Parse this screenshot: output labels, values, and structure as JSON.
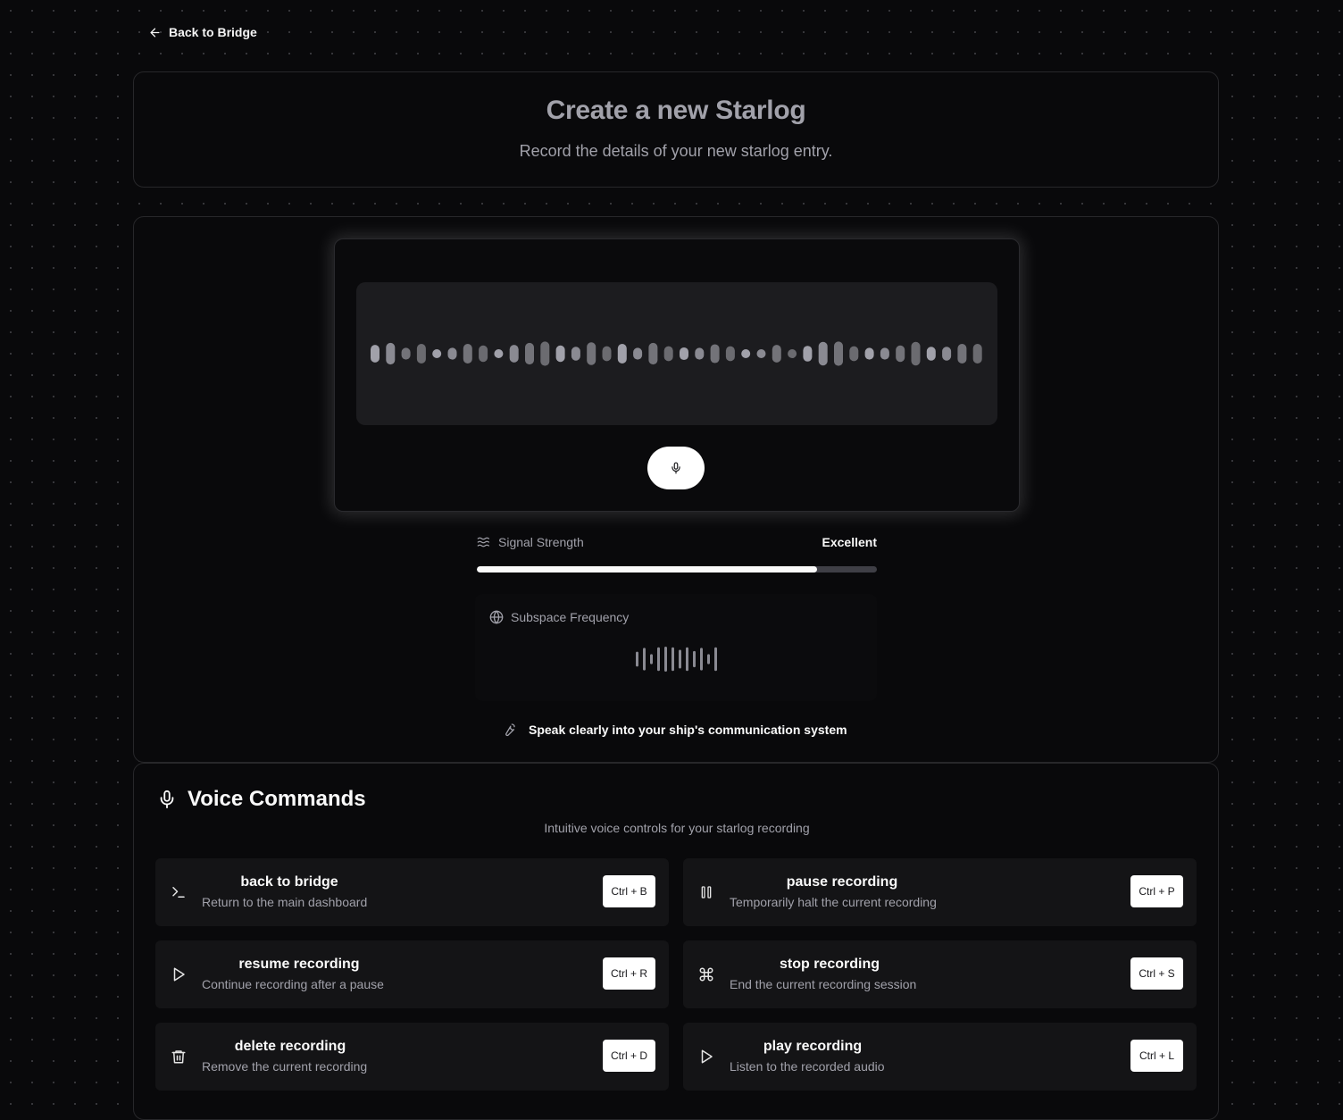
{
  "nav": {
    "back_label": "Back to Bridge"
  },
  "header": {
    "title": "Create a new Starlog",
    "subtitle": "Record the details of your new starlog entry."
  },
  "recorder": {
    "waveform_levels": [
      0.45,
      0.55,
      0.3,
      0.5,
      0.18,
      0.3,
      0.5,
      0.42,
      0.2,
      0.45,
      0.55,
      0.62,
      0.42,
      0.35,
      0.58,
      0.38,
      0.5,
      0.3,
      0.55,
      0.38,
      0.32,
      0.3,
      0.48,
      0.38,
      0.18,
      0.15,
      0.45,
      0.2,
      0.4,
      0.6,
      0.62,
      0.38,
      0.3,
      0.3,
      0.42,
      0.6,
      0.35,
      0.35,
      0.5,
      0.5
    ],
    "mic_icon": "microphone-icon"
  },
  "signal": {
    "label": "Signal Strength",
    "value": "Excellent",
    "level_percent": 85,
    "icon": "waves-icon"
  },
  "subspace": {
    "label": "Subspace Frequency",
    "icon": "globe-icon",
    "bar_levels": [
      0.6,
      0.9,
      0.4,
      0.95,
      1.0,
      0.95,
      0.75,
      0.95,
      0.65,
      0.9,
      0.4,
      0.95
    ]
  },
  "hint": {
    "icon": "wrench-icon",
    "text": "Speak clearly into your ship's communication system"
  },
  "commands": {
    "title": "Voice Commands",
    "subtitle": "Intuitive voice controls for your starlog recording",
    "items": [
      {
        "icon": "terminal-icon",
        "name": "back to bridge",
        "desc": "Return to the main dashboard",
        "key": "Ctrl + B"
      },
      {
        "icon": "pause-icon",
        "name": "pause recording",
        "desc": "Temporarily halt the current recording",
        "key": "Ctrl + P"
      },
      {
        "icon": "play-icon",
        "name": "resume recording",
        "desc": "Continue recording after a pause",
        "key": "Ctrl + R"
      },
      {
        "icon": "command-icon",
        "name": "stop recording",
        "desc": "End the current recording session",
        "key": "Ctrl + S"
      },
      {
        "icon": "trash-icon",
        "name": "delete recording",
        "desc": "Remove the current recording",
        "key": "Ctrl + D"
      },
      {
        "icon": "play-icon",
        "name": "play recording",
        "desc": "Listen to the recorded audio",
        "key": "Ctrl + L"
      }
    ]
  }
}
